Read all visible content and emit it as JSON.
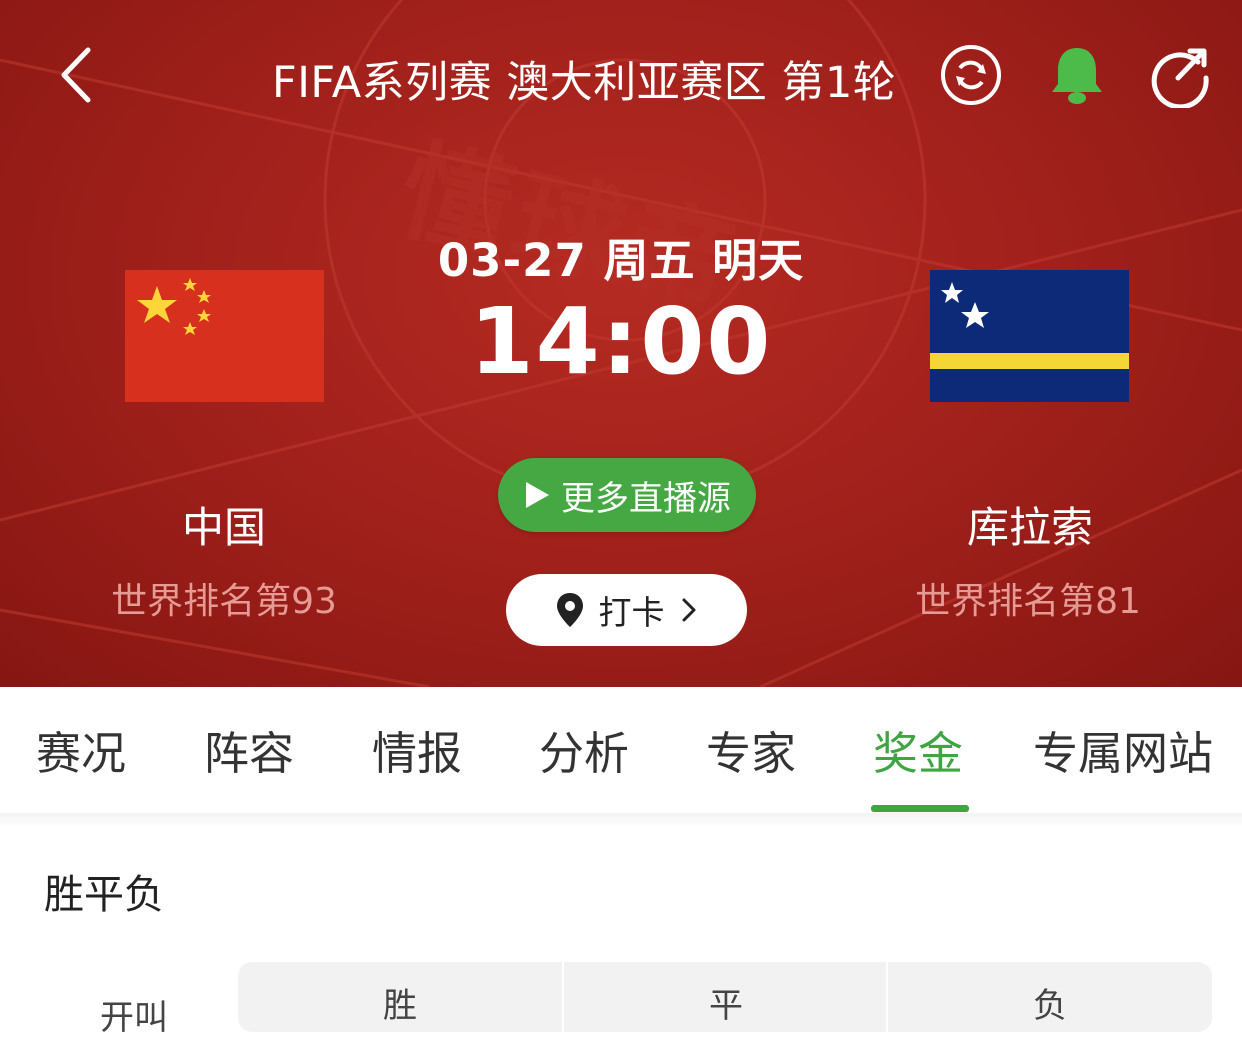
{
  "topbar": {
    "title": "FIFA系列赛 澳大利亚赛区 第1轮",
    "icons": [
      "back-chevron-icon",
      "refresh-cycle-icon",
      "bell-icon",
      "share-icon"
    ],
    "bell_color": "#4cbb4a"
  },
  "watermark": "懂球帝",
  "match": {
    "date": "03-27 周五 明天",
    "time": "14:00",
    "live_button": "更多直播源",
    "checkin_button": "打卡",
    "home": {
      "name": "中国",
      "rank": "世界排名第93",
      "flag": "china-flag"
    },
    "away": {
      "name": "库拉索",
      "rank": "世界排名第81",
      "flag": "curacao-flag"
    }
  },
  "tabs": [
    {
      "label": "赛况",
      "active": false
    },
    {
      "label": "阵容",
      "active": false
    },
    {
      "label": "情报",
      "active": false
    },
    {
      "label": "分析",
      "active": false
    },
    {
      "label": "专家",
      "active": false
    },
    {
      "label": "奖金",
      "active": true
    },
    {
      "label": "专属网站",
      "active": false
    }
  ],
  "colors": {
    "header_red": "#a8241d",
    "accent_green": "#3fa543",
    "live_green": "#45a843"
  },
  "odds": {
    "section_title": "胜平负",
    "columns": [
      "胜",
      "平",
      "负"
    ],
    "row_label": "开叫"
  }
}
